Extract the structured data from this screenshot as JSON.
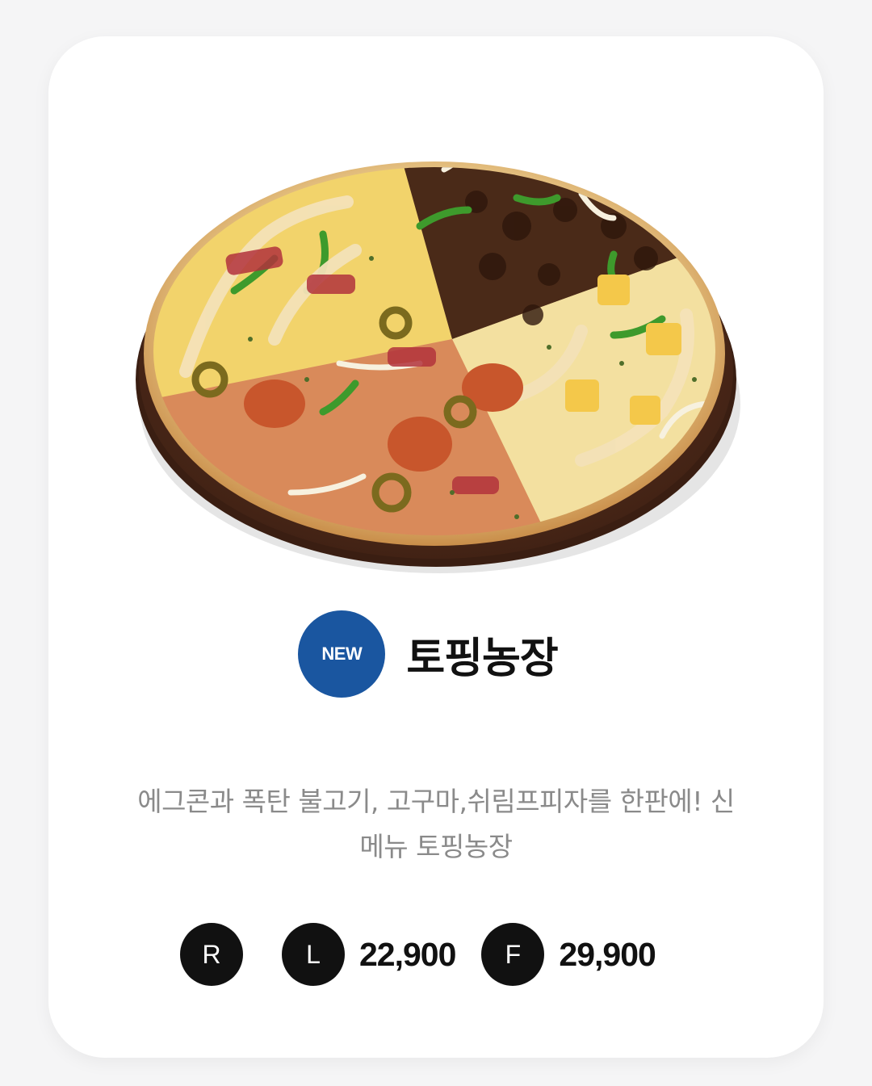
{
  "product": {
    "badge": "NEW",
    "name": "토핑농장",
    "description_line1": "에그콘과 폭탄 불고기, 고구마,쉬림프피자를 한판에! 신",
    "description_line2": "메뉴 토핑농장",
    "image_icon": "pizza-image"
  },
  "sizes": [
    {
      "label": "R",
      "price": ""
    },
    {
      "label": "L",
      "price": "22,900"
    },
    {
      "label": "F",
      "price": "29,900"
    }
  ],
  "colors": {
    "badge": "#1a56a0",
    "size_circle": "#111111",
    "description_text": "#8a8a8a",
    "title_text": "#111111"
  }
}
